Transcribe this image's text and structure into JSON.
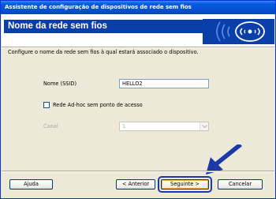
{
  "window": {
    "title": "Assistente de configuração de dispositivos de rede sem fios"
  },
  "header": {
    "title": "Nome da rede sem fios",
    "logo_icon": "wireless-logo-icon"
  },
  "instruction": "Configure o nome da rede sem fios à qual estará associado o dispositivo.",
  "form": {
    "ssid_label": "Nome (SSID)",
    "ssid_value": "HELLO2",
    "adhoc_label": "Rede Ad-hoc sem ponto de acesso",
    "adhoc_checked": false,
    "channel_label": "Canal",
    "channel_value": "1"
  },
  "buttons": {
    "help": "Ajuda",
    "back": "< Anterior",
    "next": "Seguinte >",
    "cancel": "Cancelar"
  },
  "colors": {
    "titlebar": "#0552d6",
    "header_band": "#0a3ea8",
    "highlight": "#1b3aa8"
  }
}
